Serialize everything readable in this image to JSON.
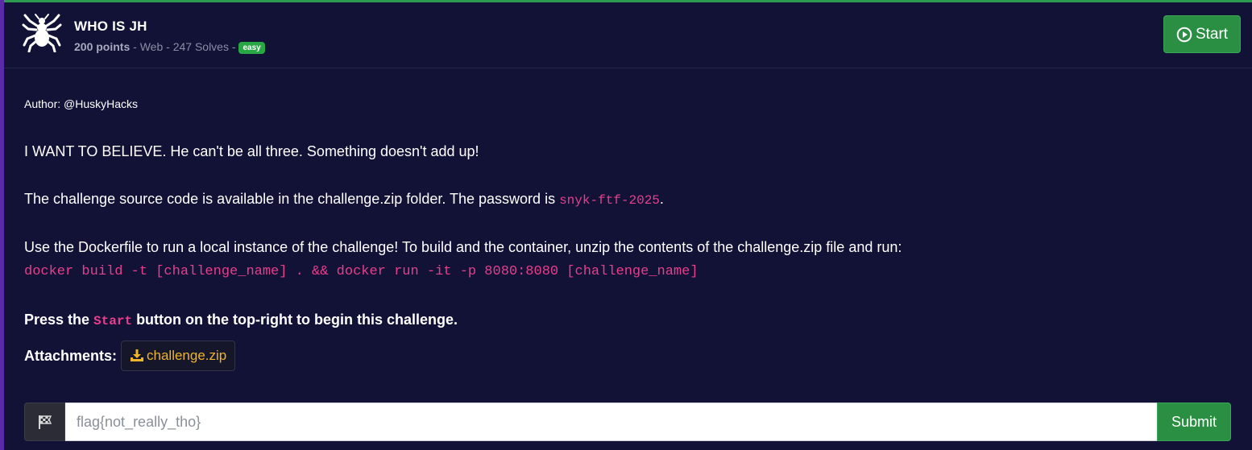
{
  "challenge": {
    "title": "WHO IS JH",
    "points": "200 points",
    "category": "Web",
    "solves": "247 Solves",
    "difficulty": "easy",
    "start_label": "Start"
  },
  "description": {
    "author": "Author: @HuskyHacks",
    "line1": "I WANT TO BELIEVE. He can't be all three. Something doesn't add up!",
    "line2_prefix": "The challenge source code is available in the challenge.zip folder. The password is ",
    "password": "snyk-ftf-2025",
    "line2_suffix": ".",
    "line3": "Use the Dockerfile to run a local instance of the challenge! To build and the container, unzip the contents of the challenge.zip file and run:",
    "command": "docker build -t [challenge_name] . && docker run -it -p 8080:8080 [challenge_name]",
    "press_prefix": "Press the ",
    "press_code": "Start",
    "press_suffix": " button on the top-right to begin this challenge."
  },
  "attachments": {
    "label": "Attachments:",
    "file": "challenge.zip"
  },
  "flag_form": {
    "placeholder": "flag{not_really_tho}",
    "submit_label": "Submit"
  },
  "colors": {
    "background": "#111236",
    "accent_green": "#2a8f43",
    "code_pink": "#e83e8c",
    "attachment_gold": "#f0b429",
    "badge_green": "#28a745"
  },
  "icons": {
    "logo": "spider-icon",
    "start": "play-circle-icon",
    "attachment": "download-icon",
    "flag": "checkered-flag-icon"
  }
}
